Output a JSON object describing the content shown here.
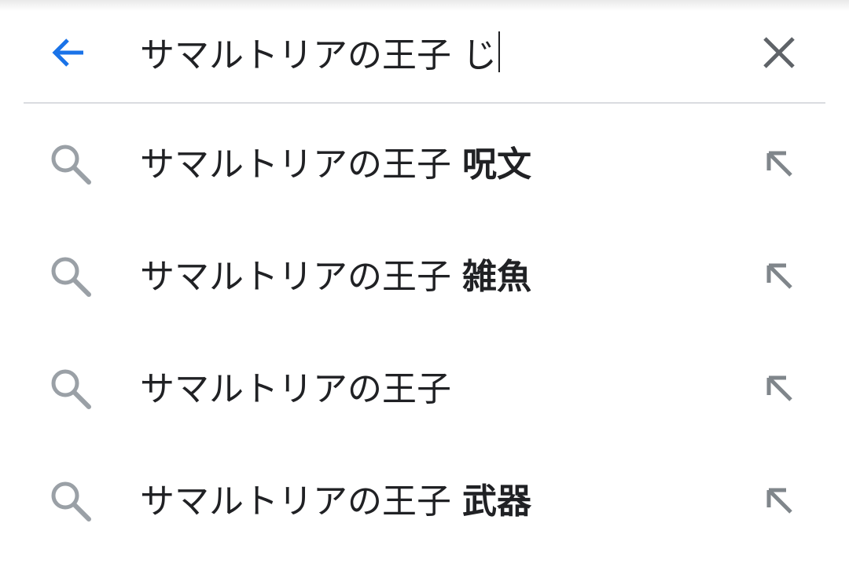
{
  "search": {
    "query": "サマルトリアの王子 じ",
    "back_icon": "arrow-back-icon",
    "clear_icon": "close-icon",
    "accent_color": "#1a73e8"
  },
  "suggestions": [
    {
      "prefix": "サマルトリアの王子 ",
      "completion": "呪文",
      "icon": "search-icon",
      "fill_icon": "arrow-up-left-icon"
    },
    {
      "prefix": "サマルトリアの王子 ",
      "completion": "雑魚",
      "icon": "search-icon",
      "fill_icon": "arrow-up-left-icon"
    },
    {
      "prefix": "サマルトリアの王子",
      "completion": "",
      "icon": "search-icon",
      "fill_icon": "arrow-up-left-icon"
    },
    {
      "prefix": "サマルトリアの王子 ",
      "completion": "武器",
      "icon": "search-icon",
      "fill_icon": "arrow-up-left-icon"
    }
  ]
}
